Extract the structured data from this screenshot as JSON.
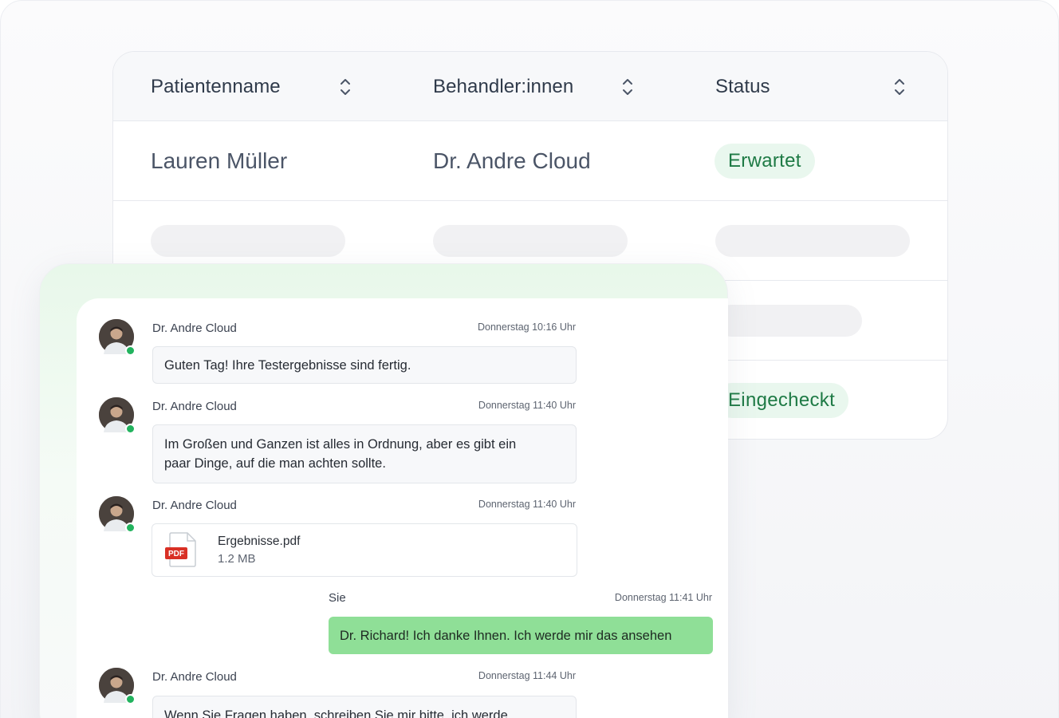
{
  "table": {
    "columns": [
      {
        "label": "Patientenname",
        "sort_icon": "sort-updown-icon"
      },
      {
        "label": "Behandler:innen",
        "sort_icon": "sort-updown-icon"
      },
      {
        "label": "Status",
        "sort_icon": "sort-updown-icon"
      }
    ],
    "rows": [
      {
        "patient": "Lauren Müller",
        "practitioner": "Dr. Andre Cloud",
        "status": "Erwartet"
      },
      {
        "patient": "",
        "practitioner": "",
        "status": "",
        "loading": true
      },
      {
        "patient": "",
        "practitioner": "",
        "status": "",
        "loading": true
      },
      {
        "patient": "",
        "practitioner": "",
        "status": "Eingecheckt"
      }
    ],
    "colors": {
      "status_bg": "#e9f7ee",
      "status_text": "#1e7a45"
    }
  },
  "chat": {
    "messages": [
      {
        "sender": "Dr. Andre Cloud",
        "time": "Donnerstag 10:16 Uhr",
        "text": "Guten Tag! Ihre Testergebnisse sind fertig.",
        "online": true
      },
      {
        "sender": "Dr. Andre Cloud",
        "time": "Donnerstag 11:40 Uhr",
        "text_line1": "Im Großen und Ganzen ist alles in Ordnung, aber es gibt ein",
        "text_line2": "paar Dinge, auf die man achten sollte.",
        "online": true
      },
      {
        "sender": "Dr. Andre Cloud",
        "time": "Donnerstag 11:40 Uhr",
        "file": {
          "name": "Ergebnisse.pdf",
          "size": "1.2 MB",
          "badge": "PDF",
          "icon": "pdf-file-icon"
        },
        "online": true
      },
      {
        "sender": "Sie",
        "time": "Donnerstag 11:41 Uhr",
        "text": "Dr. Richard! Ich danke Ihnen. Ich werde mir das ansehen",
        "own": true
      },
      {
        "sender": "Dr. Andre Cloud",
        "time": "Donnerstag 11:44 Uhr",
        "text": "Wenn Sie Fragen haben, schreiben Sie mir bitte, ich werde",
        "online": true
      }
    ],
    "colors": {
      "own_bubble": "#8fdf97",
      "online_dot": "#22b35e"
    }
  }
}
